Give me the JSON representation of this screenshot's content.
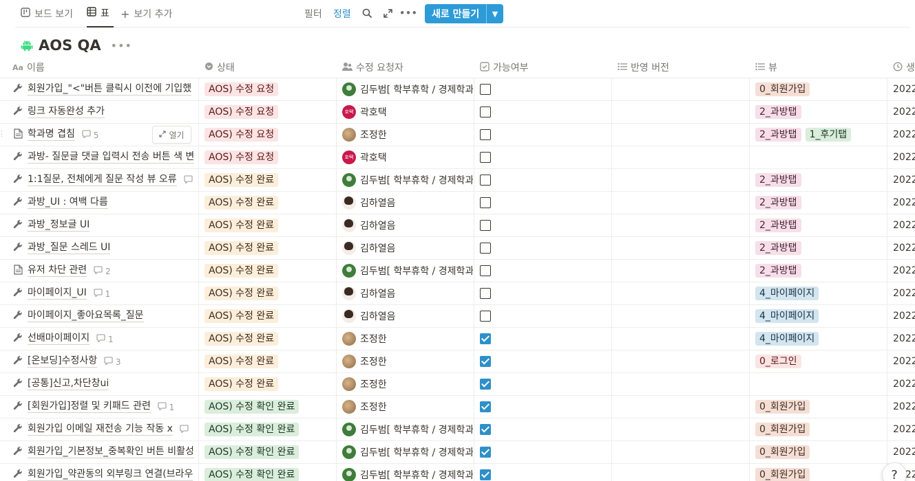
{
  "viewbar": {
    "tabs": [
      {
        "label": "보드 보기",
        "icon": "board-icon",
        "active": false
      },
      {
        "label": "표",
        "icon": "table-icon",
        "active": true
      },
      {
        "label": "보기 추가",
        "icon": "plus-icon",
        "active": false
      }
    ],
    "filter_label": "필터",
    "sort_label": "정렬",
    "new_button_label": "새로 만들기"
  },
  "page": {
    "title": "AOS QA",
    "title_icon": "android-icon"
  },
  "columns": [
    {
      "label": "이름",
      "icon": "text-aa-icon"
    },
    {
      "label": "상태",
      "icon": "status-icon"
    },
    {
      "label": "수정 요청자",
      "icon": "person-icon"
    },
    {
      "label": "가능여부",
      "icon": "checkbox-icon"
    },
    {
      "label": "반영 버전",
      "icon": "list-icon"
    },
    {
      "label": "뷰",
      "icon": "list-icon"
    },
    {
      "label": "생",
      "icon": "clock-icon"
    }
  ],
  "open_button_label": "열기",
  "status_colors": {
    "AOS) 수정 요청": {
      "bg": "#fbe4e4",
      "fg": "#5d1715"
    },
    "AOS) 수정 완료": {
      "bg": "#fbeeda",
      "fg": "#402c1b"
    },
    "AOS) 수정 확인 완료": {
      "bg": "#dbeddb",
      "fg": "#1c3829"
    }
  },
  "view_colors": {
    "0_회원가입": {
      "bg": "#f4dfd6",
      "fg": "#44291d"
    },
    "2_과방탭": {
      "bg": "#f6dfe8",
      "fg": "#4c2337"
    },
    "1_후기탭": {
      "bg": "#dbeddb",
      "fg": "#1c3829"
    },
    "4_마이페이지": {
      "bg": "#d3e5ef",
      "fg": "#183347"
    },
    "0_로그인": {
      "bg": "#fbe4e4",
      "fg": "#5d1715"
    }
  },
  "rows": [
    {
      "icon": "wrench-icon",
      "name": "회원가입_\"<\"버튼 클릭시 이전에 기입했",
      "comments": "",
      "status": "AOS) 수정 요청",
      "person": "김두범[ 학부휴학 / 경제학과 ]",
      "avatar": "green",
      "checked": false,
      "version": "",
      "views": [
        "0_회원가입"
      ],
      "date": "2022"
    },
    {
      "icon": "wrench-icon",
      "name": "링크 자동완성 추가",
      "comments": "",
      "status": "AOS) 수정 요청",
      "person": "곽호택",
      "avatar": "red",
      "avatar_text": "호택",
      "checked": false,
      "version": "",
      "views": [
        "2_과방탭"
      ],
      "date": "2022"
    },
    {
      "icon": "page-icon",
      "name": "학과명 겹침",
      "comments": "5",
      "status": "AOS) 수정 요청",
      "person": "조정한",
      "avatar": "brown",
      "checked": false,
      "version": "",
      "views": [
        "2_과방탭",
        "1_후기탭"
      ],
      "date": "2022",
      "hover": true
    },
    {
      "icon": "wrench-icon",
      "name": "과방- 질문글 댓글 입력시 전송 버튼 색 변",
      "comments": "",
      "status": "AOS) 수정 요청",
      "person": "곽호택",
      "avatar": "red",
      "avatar_text": "호택",
      "checked": false,
      "version": "",
      "views": [],
      "date": "2022"
    },
    {
      "icon": "wrench-icon",
      "name": "1:1질문, 전체에게 질문 작성 뷰 오류",
      "comments": "",
      "status": "AOS) 수정 완료",
      "person": "김두범[ 학부휴학 / 경제학과 ]",
      "avatar": "green",
      "checked": false,
      "version": "",
      "views": [
        "2_과방탭"
      ],
      "date": "2022",
      "comment_icon_only": true
    },
    {
      "icon": "wrench-icon",
      "name": "과방_UI : 여백 다름",
      "comments": "",
      "status": "AOS) 수정 완료",
      "person": "김하열음",
      "avatar": "girl",
      "checked": false,
      "version": "",
      "views": [
        "2_과방탭"
      ],
      "date": "2022"
    },
    {
      "icon": "wrench-icon",
      "name": "과방_정보글 UI",
      "comments": "",
      "status": "AOS) 수정 완료",
      "person": "김하열음",
      "avatar": "girl",
      "checked": false,
      "version": "",
      "views": [
        "2_과방탭"
      ],
      "date": "2022"
    },
    {
      "icon": "wrench-icon",
      "name": "과방_질문 스레드 UI",
      "comments": "",
      "status": "AOS) 수정 완료",
      "person": "김하열음",
      "avatar": "girl",
      "checked": false,
      "version": "",
      "views": [
        "2_과방탭"
      ],
      "date": "2022"
    },
    {
      "icon": "page-icon",
      "name": "유저 차단 관련",
      "comments": "2",
      "status": "AOS) 수정 완료",
      "person": "김두범[ 학부휴학 / 경제학과 ]",
      "avatar": "green",
      "checked": false,
      "version": "",
      "views": [
        "2_과방탭"
      ],
      "date": "2022"
    },
    {
      "icon": "wrench-icon",
      "name": "마이페이지_UI",
      "comments": "1",
      "status": "AOS) 수정 완료",
      "person": "김하열음",
      "avatar": "girl",
      "checked": false,
      "version": "",
      "views": [
        "4_마이페이지"
      ],
      "date": "2022"
    },
    {
      "icon": "wrench-icon",
      "name": "마이페이지_좋아요목록_질문",
      "comments": "",
      "status": "AOS) 수정 완료",
      "person": "김하열음",
      "avatar": "girl",
      "checked": false,
      "version": "",
      "views": [
        "4_마이페이지"
      ],
      "date": "2022"
    },
    {
      "icon": "wrench-icon",
      "name": "선배마이페이지",
      "comments": "1",
      "status": "AOS) 수정 완료",
      "person": "조정한",
      "avatar": "brown",
      "checked": true,
      "version": "",
      "views": [
        "4_마이페이지"
      ],
      "date": "2022"
    },
    {
      "icon": "wrench-icon",
      "name": "[온보딩]수정사항",
      "comments": "3",
      "status": "AOS) 수정 완료",
      "person": "조정한",
      "avatar": "brown",
      "checked": true,
      "version": "",
      "views": [
        "0_로그인"
      ],
      "date": "2022"
    },
    {
      "icon": "wrench-icon",
      "name": "[공통]신고,차단창ui",
      "comments": "",
      "status": "AOS) 수정 완료",
      "person": "조정한",
      "avatar": "brown",
      "checked": true,
      "version": "",
      "views": [],
      "date": "2022"
    },
    {
      "icon": "wrench-icon",
      "name": "[회원가입]정렬 및 키패드 관련",
      "comments": "1",
      "status": "AOS) 수정 확인 완료",
      "person": "조정한",
      "avatar": "brown",
      "checked": true,
      "version": "",
      "views": [
        "0_회원가입"
      ],
      "date": "2022"
    },
    {
      "icon": "wrench-icon",
      "name": "회원가입 이메일 재전송 기능 작동 x",
      "comments": "",
      "status": "AOS) 수정 확인 완료",
      "person": "김두범[ 학부휴학 / 경제학과 ]",
      "avatar": "green",
      "checked": true,
      "version": "",
      "views": [
        "0_회원가입"
      ],
      "date": "2022",
      "comment_icon_only": true
    },
    {
      "icon": "wrench-icon",
      "name": "회원가입_기본정보_중복확인 버튼 비활성",
      "comments": "",
      "status": "AOS) 수정 확인 완료",
      "person": "김두범[ 학부휴학 / 경제학과 ]",
      "avatar": "green",
      "checked": true,
      "version": "",
      "views": [
        "0_회원가입"
      ],
      "date": "2022"
    },
    {
      "icon": "wrench-icon",
      "name": "회원가입_약관동의 외부링크 연결(브라우",
      "comments": "",
      "status": "AOS) 수정 확인 완료",
      "person": "김두범[ 학부휴학 / 경제학과 ]",
      "avatar": "green",
      "checked": true,
      "version": "",
      "views": [
        "0_회원가입"
      ],
      "date": "2022"
    }
  ],
  "help_label": "?"
}
